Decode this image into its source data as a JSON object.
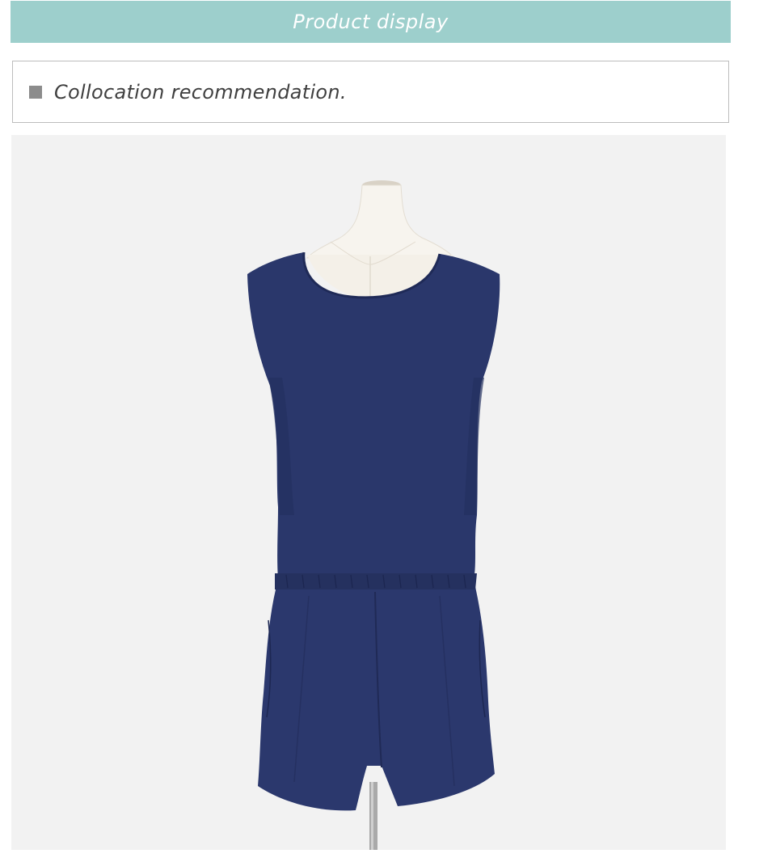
{
  "header": {
    "title": "Product display",
    "background_color": "#9dcfcc"
  },
  "section": {
    "bullet_icon": "square-bullet-icon",
    "title": "Collocation recommendation."
  },
  "product_image": {
    "subject": "navy sleeveless romper on mannequin",
    "garment_color": "#283569",
    "background_color": "#f2f2f2"
  }
}
